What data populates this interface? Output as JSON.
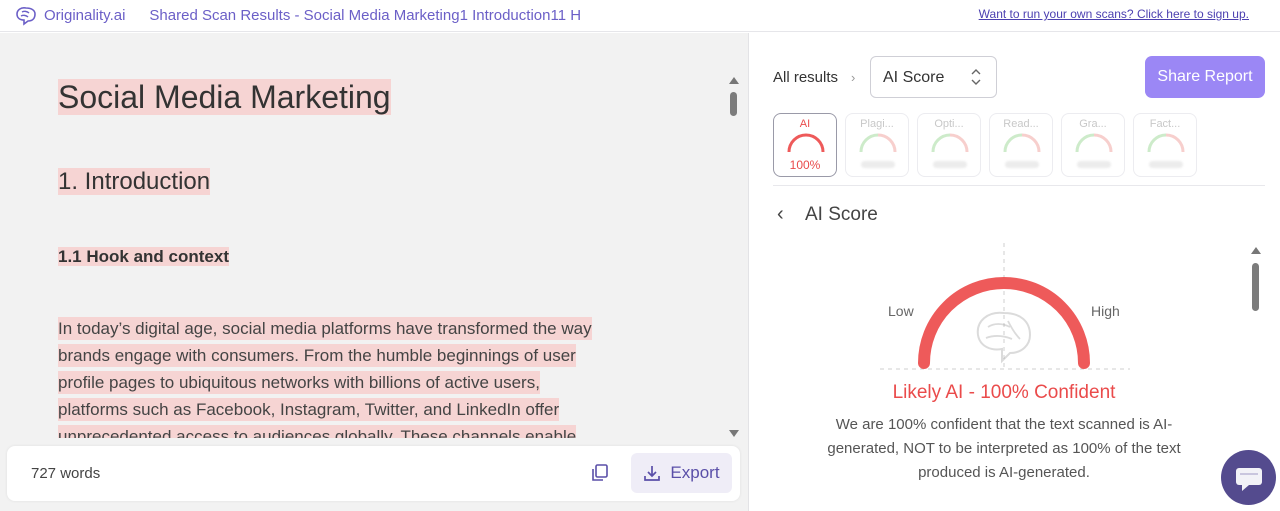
{
  "app": {
    "name": "Originality.ai",
    "title": "Shared Scan Results - Social Media Marketing1 Introduction11 H",
    "signup_link": "Want to run your own scans? Click here to sign up."
  },
  "document": {
    "h1": "Social Media Marketing",
    "h2": "1. Introduction",
    "h3": "1.1 Hook and context",
    "paragraph_lines": [
      "In today’s digital age, social media platforms have transformed the way",
      "brands engage with consumers. From the humble beginnings of user",
      "profile pages to ubiquitous networks with billions of active users,",
      "platforms such as Facebook, Instagram, Twitter, and LinkedIn offer",
      "unprecedented access to audiences globally. These channels enable"
    ],
    "highlight_color": "#f6d4d3"
  },
  "bottom_bar": {
    "word_count": "727 words",
    "export_label": "Export"
  },
  "right": {
    "breadcrumb": "All results",
    "select_value": "AI Score",
    "share_label": "Share Report",
    "tiles": [
      {
        "label": "AI",
        "value": "100%",
        "active": true
      },
      {
        "label": "Plagi...",
        "value": "",
        "active": false
      },
      {
        "label": "Opti...",
        "value": "",
        "active": false
      },
      {
        "label": "Read...",
        "value": "",
        "active": false
      },
      {
        "label": "Gra...",
        "value": "",
        "active": false
      },
      {
        "label": "Fact...",
        "value": "",
        "active": false
      }
    ],
    "section_title": "AI Score",
    "gauge": {
      "low_label": "Low",
      "high_label": "High",
      "level": 1.0,
      "color": "#ee5a5a"
    },
    "verdict": "Likely AI - 100% Confident",
    "explanation": "We are 100% confident that the text scanned is AI-generated, NOT to be interpreted as 100% of the text produced is AI-generated."
  },
  "colors": {
    "accent": "#9b87f5",
    "brand_text": "#6b5fc7",
    "alert": "#ea4b4b"
  },
  "icons": [
    "brain-logo-icon",
    "copy-icon",
    "download-icon",
    "chevron-right-icon",
    "chevron-left-icon",
    "sort-caret-icon",
    "brain-icon",
    "chat-icon"
  ]
}
